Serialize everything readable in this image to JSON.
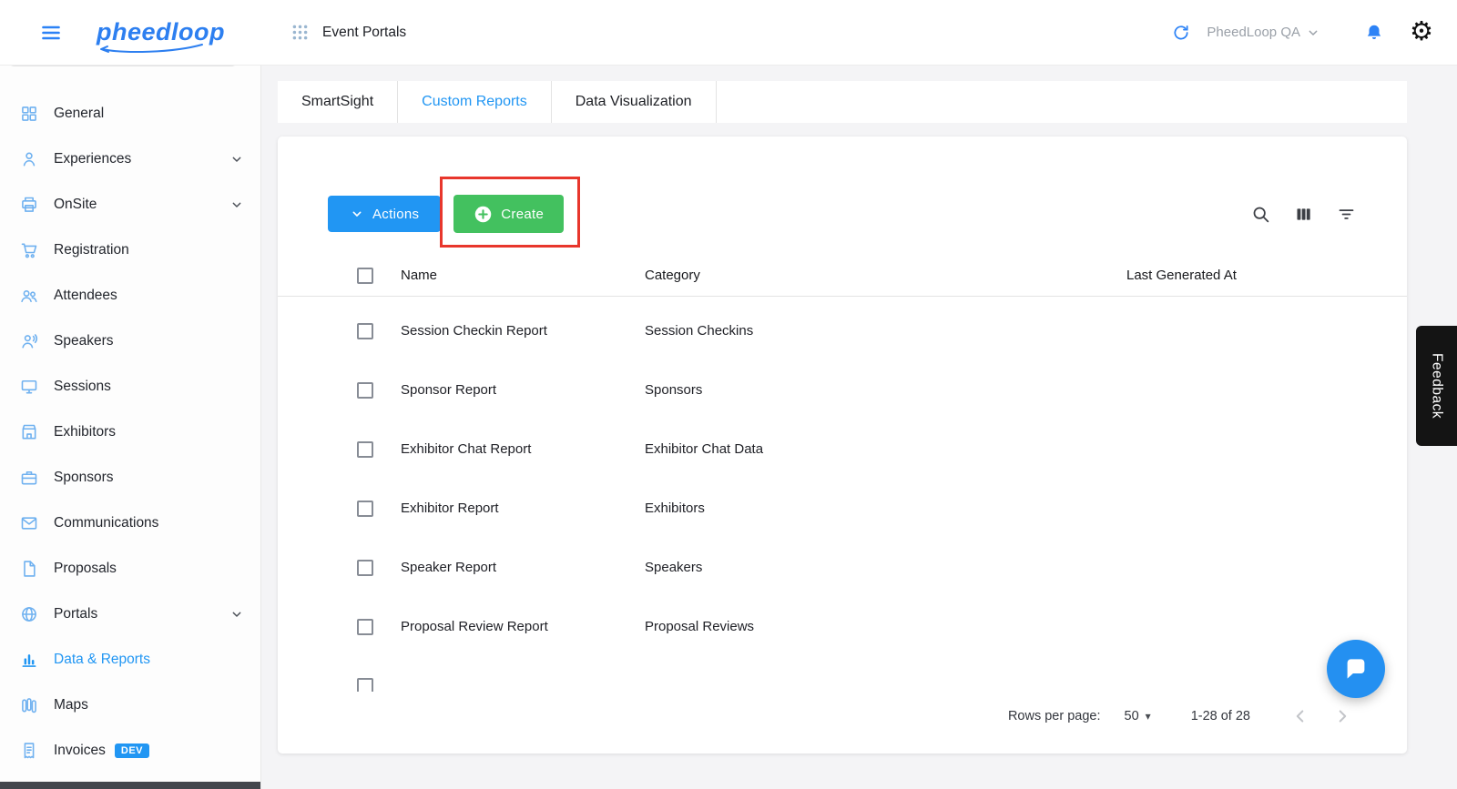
{
  "logo_text": "pheedloop",
  "topbar": {
    "page_title": "Event Portals",
    "account_name": "PheedLoop QA"
  },
  "sidebar": {
    "items": [
      {
        "label": "General",
        "icon": "grid-icon"
      },
      {
        "label": "Experiences",
        "icon": "person-icon",
        "expandable": true
      },
      {
        "label": "OnSite",
        "icon": "printer-icon",
        "expandable": true
      },
      {
        "label": "Registration",
        "icon": "cart-icon"
      },
      {
        "label": "Attendees",
        "icon": "people-icon"
      },
      {
        "label": "Speakers",
        "icon": "speaker-icon"
      },
      {
        "label": "Sessions",
        "icon": "monitor-icon"
      },
      {
        "label": "Exhibitors",
        "icon": "store-icon"
      },
      {
        "label": "Sponsors",
        "icon": "briefcase-icon"
      },
      {
        "label": "Communications",
        "icon": "mail-icon"
      },
      {
        "label": "Proposals",
        "icon": "document-icon"
      },
      {
        "label": "Portals",
        "icon": "globe-icon",
        "expandable": true
      },
      {
        "label": "Data & Reports",
        "icon": "chart-icon",
        "active": true
      },
      {
        "label": "Maps",
        "icon": "map-icon"
      },
      {
        "label": "Invoices",
        "icon": "invoice-icon",
        "badge": "DEV"
      }
    ]
  },
  "tabs": [
    {
      "label": "SmartSight"
    },
    {
      "label": "Custom Reports",
      "active": true
    },
    {
      "label": "Data Visualization"
    }
  ],
  "toolbar": {
    "actions_label": "Actions",
    "create_label": "Create"
  },
  "table": {
    "columns": [
      "Name",
      "Category",
      "Last Generated At"
    ],
    "rows": [
      {
        "name": "Session Checkin Report",
        "category": "Session Checkins"
      },
      {
        "name": "Sponsor Report",
        "category": "Sponsors"
      },
      {
        "name": "Exhibitor Chat Report",
        "category": "Exhibitor Chat Data"
      },
      {
        "name": "Exhibitor Report",
        "category": "Exhibitors"
      },
      {
        "name": "Speaker Report",
        "category": "Speakers"
      },
      {
        "name": "Proposal Review Report",
        "category": "Proposal Reviews"
      }
    ]
  },
  "pagination": {
    "rows_per_page_label": "Rows per page:",
    "rows_per_page_value": "50",
    "range_text": "1-28 of 28"
  },
  "feedback_label": "Feedback",
  "colors": {
    "accent_blue": "#2196f3",
    "icon_blue": "#6fb1f0",
    "green": "#43c15f",
    "annotation_red": "#e8362c"
  }
}
